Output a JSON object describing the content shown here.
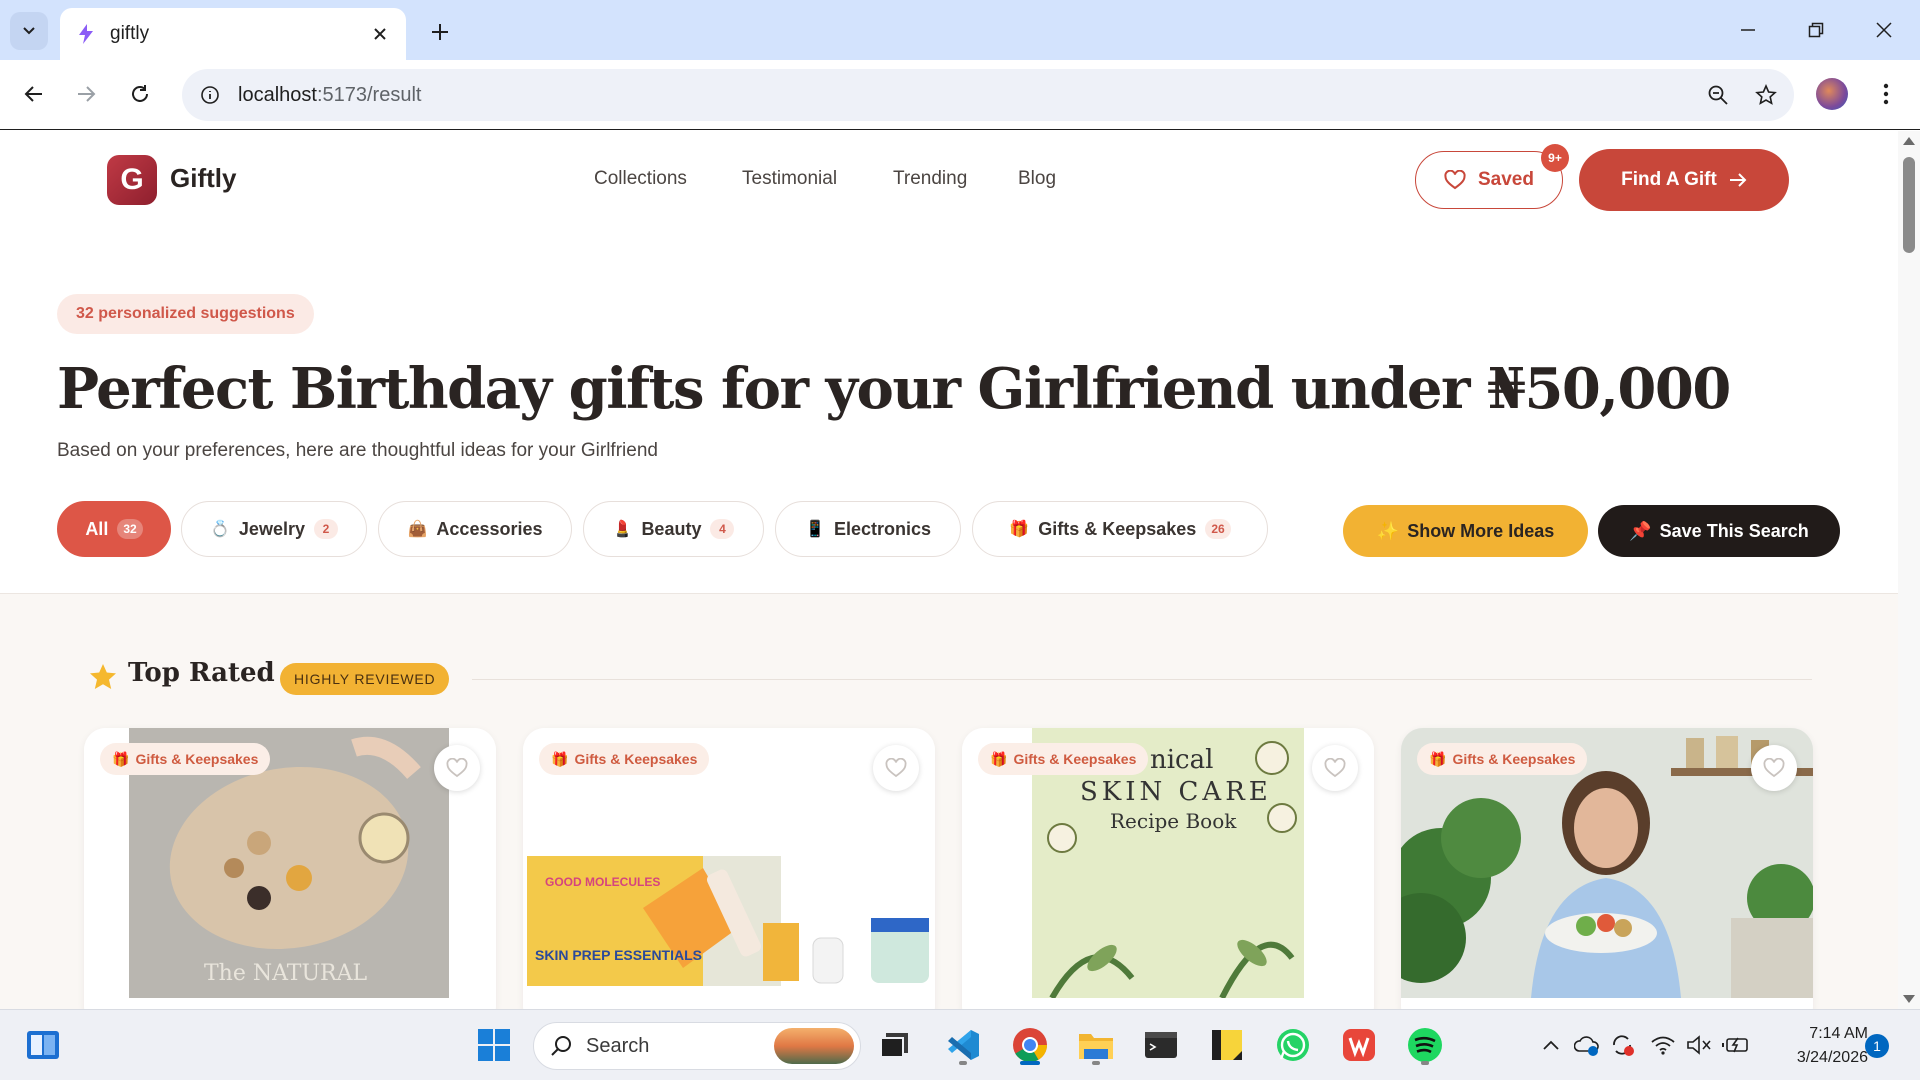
{
  "browser": {
    "tab_title": "giftly",
    "url_host": "localhost",
    "url_path": ":5173/result"
  },
  "site": {
    "logo_letter": "G",
    "brand": "Giftly",
    "nav": [
      "Collections",
      "Testimonial",
      "Trending",
      "Blog"
    ],
    "saved_label": "Saved",
    "saved_badge": "9+",
    "find_label": "Find A Gift"
  },
  "hero": {
    "suggestions_pill": "32 personalized suggestions",
    "title": "Perfect Birthday gifts for your Girlfriend under ₦50,000",
    "subtitle": "Based on your preferences, here are thoughtful ideas for your Girlfriend"
  },
  "filters": {
    "chips": [
      {
        "label": "All",
        "count": "32",
        "icon": "",
        "active": true
      },
      {
        "label": "Jewelry",
        "count": "2",
        "icon": "💍"
      },
      {
        "label": "Accessories",
        "count": "",
        "icon": "👜"
      },
      {
        "label": "Beauty",
        "count": "4",
        "icon": "💄"
      },
      {
        "label": "Electronics",
        "count": "",
        "icon": "📱"
      },
      {
        "label": "Gifts & Keepsakes",
        "count": "26",
        "icon": "🎁"
      }
    ],
    "show_more": "Show More Ideas",
    "save_search": "Save This Search"
  },
  "section": {
    "title": "Top Rated",
    "badge": "HIGHLY REVIEWED"
  },
  "cards": [
    {
      "tag": "Gifts & Keepsakes",
      "image": "natural-skincare-book"
    },
    {
      "tag": "Gifts & Keepsakes",
      "image": "good-molecules-skin-prep-kit",
      "text1": "GOOD MOLECULES",
      "text2": "SKIN PREP ESSENTIALS"
    },
    {
      "tag": "Gifts & Keepsakes",
      "image": "botanical-skin-care-recipe-book",
      "text1": "nical",
      "text2": "SKIN CARE",
      "text3": "Recipe Book"
    },
    {
      "tag": "Gifts & Keepsakes",
      "image": "woman-with-salad-bowl"
    }
  ],
  "taskbar": {
    "search_label": "Search",
    "time": "7:14 AM",
    "date": "3/24/2026",
    "notifications": "1"
  },
  "colors": {
    "brand": "#c8473a",
    "accent_yellow": "#f2b233",
    "dark": "#211b19",
    "tab_bar": "#d3e3fd"
  }
}
